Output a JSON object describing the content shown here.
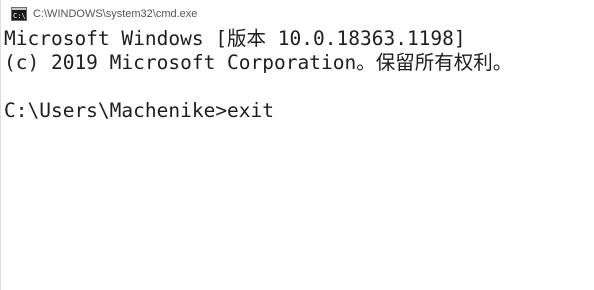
{
  "window": {
    "title": "C:\\WINDOWS\\system32\\cmd.exe",
    "icon": "cmd-console-icon"
  },
  "console": {
    "lines": [
      "Microsoft Windows [版本 10.0.18363.1198]",
      "(c) 2019 Microsoft Corporation。保留所有权利。",
      "",
      "C:\\Users\\Machenike>exit"
    ]
  },
  "colors": {
    "background": "#ffffff",
    "text": "#1e1e1e",
    "title_text": "#555555"
  }
}
